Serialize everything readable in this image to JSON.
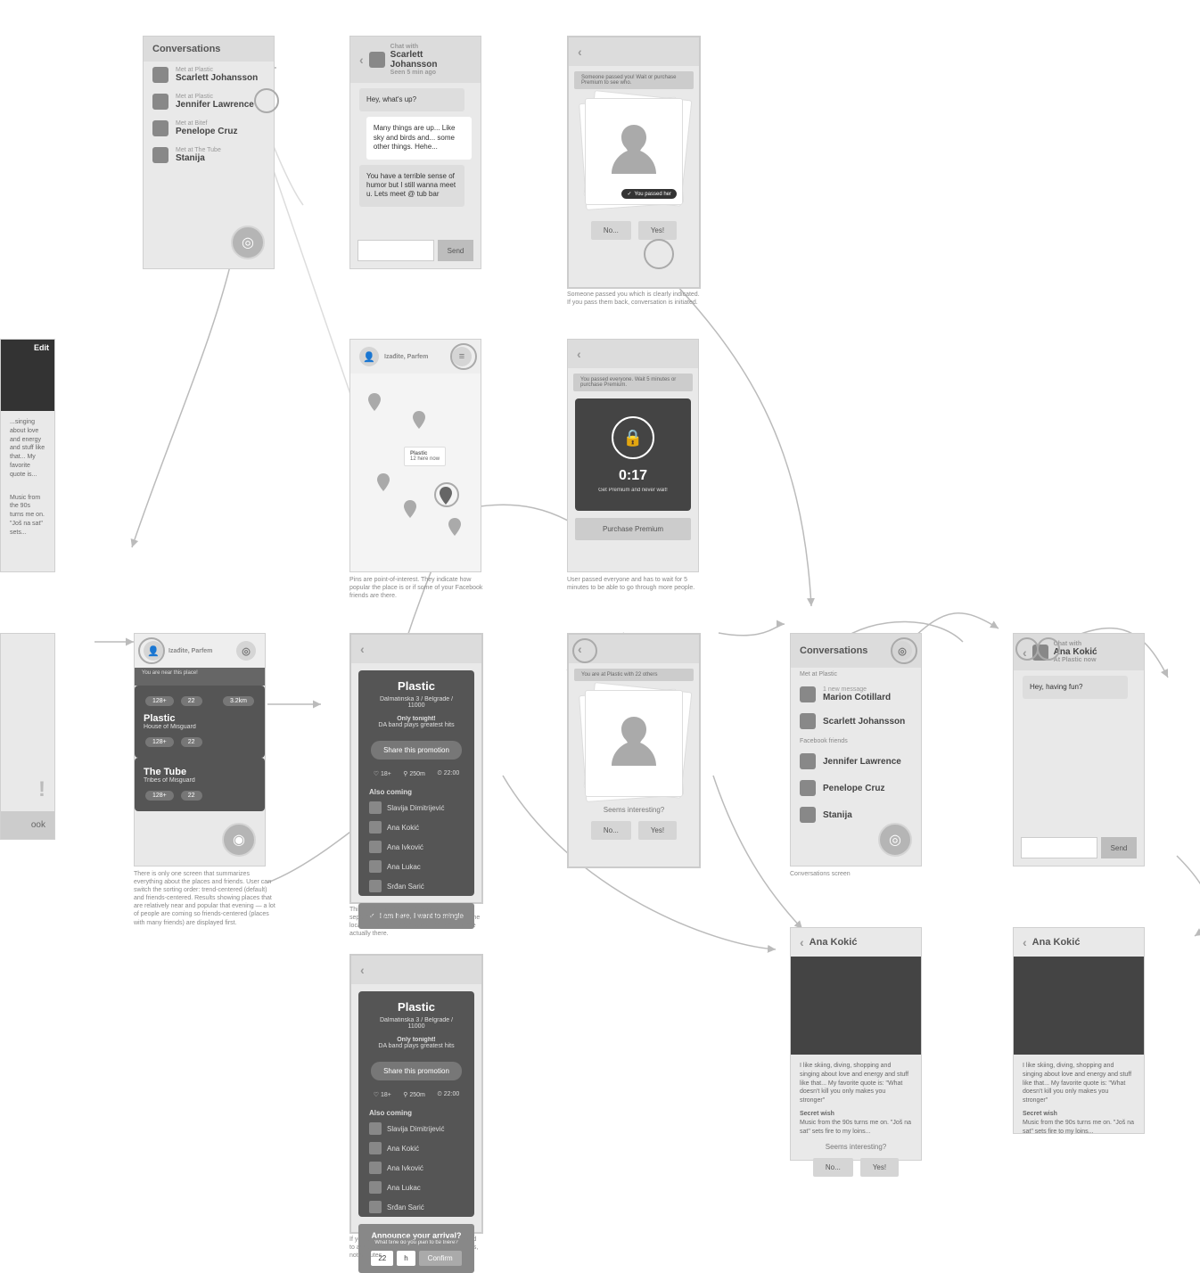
{
  "screens": {
    "convo1": {
      "title": "Conversations",
      "items": [
        {
          "caption": "Met at Plastic",
          "name": "Scarlett Johansson"
        },
        {
          "caption": "Met at Plastic",
          "name": "Jennifer Lawrence"
        },
        {
          "caption": "Met at Bitef",
          "name": "Penelope Cruz"
        },
        {
          "caption": "Met at The Tube",
          "name": "Stanija"
        }
      ]
    },
    "chat1": {
      "header_caption": "Chat with",
      "header_name": "Scarlett Johansson",
      "header_sub": "Seen 5 min ago",
      "messages": [
        {
          "dir": "in",
          "text": "Hey, what's up?"
        },
        {
          "dir": "out",
          "text": "Many things are up... Like sky and birds and... some other things. Hehe..."
        },
        {
          "dir": "in",
          "text": "You have a terrible sense of humor but I still wanna meet u. Lets meet @ tub bar"
        }
      ],
      "send": "Send"
    },
    "map": {
      "search": "Izađite, Parfem",
      "popover": "Plastic",
      "popover_sub": "12 here now",
      "caption": "Pins are point-of-interest. They indicate how popular the place is or if some of your Facebook friends are there."
    },
    "feed": {
      "search": "Izađite, Parfem",
      "near_label": "You are near this place!",
      "venue1": {
        "name": "Plastic",
        "sub": "House of Misguard"
      },
      "venue2": {
        "name": "The Tube",
        "sub": "Tribes of Misguard"
      },
      "pills": [
        "128+",
        "22",
        "3.2km"
      ],
      "pills2": [
        "128+",
        "22"
      ],
      "caption": "There is only one screen that summarizes everything about the places and friends. User can switch the sorting order: trend-centered (default) and friends-centered. Results showing places that are relatively near and popular that evening — a lot of people are coming so friends-centered (places with many friends) are displayed first."
    },
    "venue_detail": {
      "name": "Plastic",
      "location": "Dalmatinska 3 / Belgrade / 11000",
      "event": "Only tonight!",
      "event_sub": "DA band plays greatest hits",
      "share": "Share this promotion",
      "stats": [
        "18+",
        "250m",
        "22:00"
      ],
      "also": "Also coming",
      "people": [
        "Slavija Dimitrijević",
        "Ana Kokić",
        "Ana Ivković",
        "Ana Lukac",
        "Srđan Sarić"
      ],
      "cta": "I am here, I want to mingle",
      "caption": "This is no longer a modal window but a separate screen. If you are close enough to the location you are asked to confirm that you are actually there."
    },
    "venue_announce": {
      "announce_title": "Announce your arrival?",
      "announce_sub": "What time do you plan to be there?",
      "hours": "22",
      "h": "h",
      "confirm": "Confirm",
      "caption": "If you are not near the location, you are asked to announce your arrival specifying only hours, not minutes."
    },
    "passed": {
      "banner": "Someone passed you! Wait or purchase Premium to see who.",
      "chip": "You passed her",
      "btn_no": "No...",
      "btn_yes": "Yes!",
      "caption": "Someone passed you which is clearly indicated. If you pass them back, conversation is initiated."
    },
    "locked": {
      "banner": "You passed everyone. Wait 5 minutes or purchase Premium.",
      "timer": "0:17",
      "timer_sub": "Get Premium and never wait!",
      "purchase": "Purchase Premium",
      "caption": "User passed everyone and has to wait for 5 minutes to be able to go through more people."
    },
    "swipe": {
      "banner": "You are at Plastic with 22 others",
      "question": "Seems interesting?",
      "btn_no": "No...",
      "btn_yes": "Yes!"
    },
    "convo2": {
      "title": "Conversations",
      "section1": "Met at Plastic",
      "items1": [
        {
          "caption": "1 new message",
          "name": "Marion Cotillard"
        },
        {
          "name": "Scarlett Johansson"
        }
      ],
      "section2": "Facebook friends",
      "items2": [
        {
          "name": "Jennifer Lawrence"
        },
        {
          "name": "Penelope Cruz"
        },
        {
          "name": "Stanija"
        }
      ],
      "caption": "Conversations screen"
    },
    "chat2": {
      "header_caption": "Chat with",
      "header_name": "Ana Kokić",
      "header_sub": "At Plastic now",
      "msg": "Hey, having fun?",
      "send": "Send"
    },
    "profile": {
      "name": "Ana Kokić",
      "bio": "I like skiing, diving, shopping and singing about love and energy and stuff like that... My favorite quote is: \"What doesn't kill you only makes you stronger\"",
      "secret_label": "Secret wish",
      "secret": "Music from the 90s turns me on. \"Još na sat\" sets fire to my loins...",
      "question": "Seems interesting?",
      "btn_no": "No...",
      "btn_yes": "Yes!"
    },
    "edit": {
      "label": "Edit",
      "bio_snip": "...singing about love and energy and stuff like that... My favorite quote is...",
      "secret": "Music from the 90s turns me on. \"Još na sat\" sets..."
    },
    "fb": {
      "title": "!",
      "btn": "ook"
    }
  }
}
